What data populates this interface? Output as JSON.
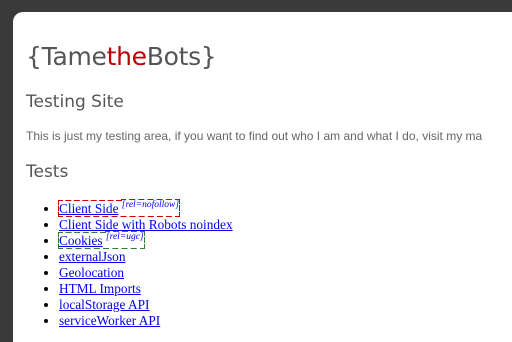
{
  "logo": {
    "open": "{Tame",
    "accent": "the",
    "close": "Bots}"
  },
  "headings": {
    "site": "Testing Site",
    "tests": "Tests"
  },
  "intro": "This is just my testing area, if you want to find out who I am and what I do, visit my ma",
  "tests": [
    {
      "label": "Client Side",
      "rel": "[rel=nofollow]"
    },
    {
      "label": "Client Side with Robots noindex"
    },
    {
      "label": "Cookies",
      "rel": "[rel=ugc]"
    },
    {
      "label": "externalJson"
    },
    {
      "label": "Geolocation"
    },
    {
      "label": "HTML Imports"
    },
    {
      "label": "localStorage API"
    },
    {
      "label": "serviceWorker API"
    }
  ],
  "colors": {
    "background": "#3a3a3a",
    "logo_accent": "#c00000",
    "link": "#0000ee",
    "nofollow_outline": "#d00000",
    "ugc_outline": "#2e7d32"
  }
}
